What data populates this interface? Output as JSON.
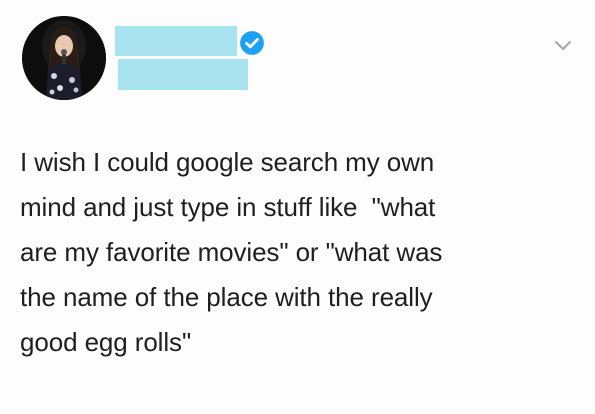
{
  "tweet": {
    "text": "I wish I could google search my own\nmind and just type in stuff like  \"what\nare my favorite movies\" or \"what was\nthe name of the place with the really\ngood egg rolls\""
  },
  "icons": {
    "verified": "verified-badge-icon",
    "menu": "chevron-down-icon"
  },
  "colors": {
    "redaction": "#a9e3f0",
    "verified": "#1da1f2",
    "text": "#1f1f1f"
  }
}
